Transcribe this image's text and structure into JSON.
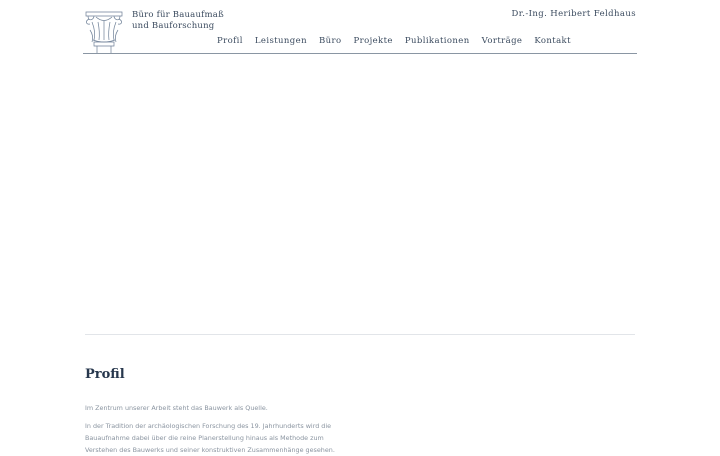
{
  "header": {
    "brand_line1": "Büro für Bauaufmaß",
    "brand_line2": "und Bauforschung",
    "owner": "Dr.-Ing. Heribert Feldhaus"
  },
  "nav": {
    "items": [
      {
        "label": "Profil"
      },
      {
        "label": "Leistungen"
      },
      {
        "label": "Büro"
      },
      {
        "label": "Projekte"
      },
      {
        "label": "Publikationen"
      },
      {
        "label": "Vorträge"
      },
      {
        "label": "Kontakt"
      }
    ]
  },
  "profile": {
    "title": "Profil",
    "intro": "Im Zentrum unserer Arbeit steht das Bauwerk als Quelle.",
    "body": "In der Tradition der archäologischen Forschung des 19. Jahrhunderts wird die Bauaufnahme dabei über die reine Planerstellung hinaus als Methode zum Verstehen des Bauwerks und seiner konstruktiven Zusammenhänge gesehen."
  },
  "colors": {
    "text": "#3a4a5e",
    "title": "#27374d",
    "body_text": "#8a94a0",
    "rule": "#8a96a3"
  },
  "icons": {
    "logo": "capital-column-logo"
  }
}
